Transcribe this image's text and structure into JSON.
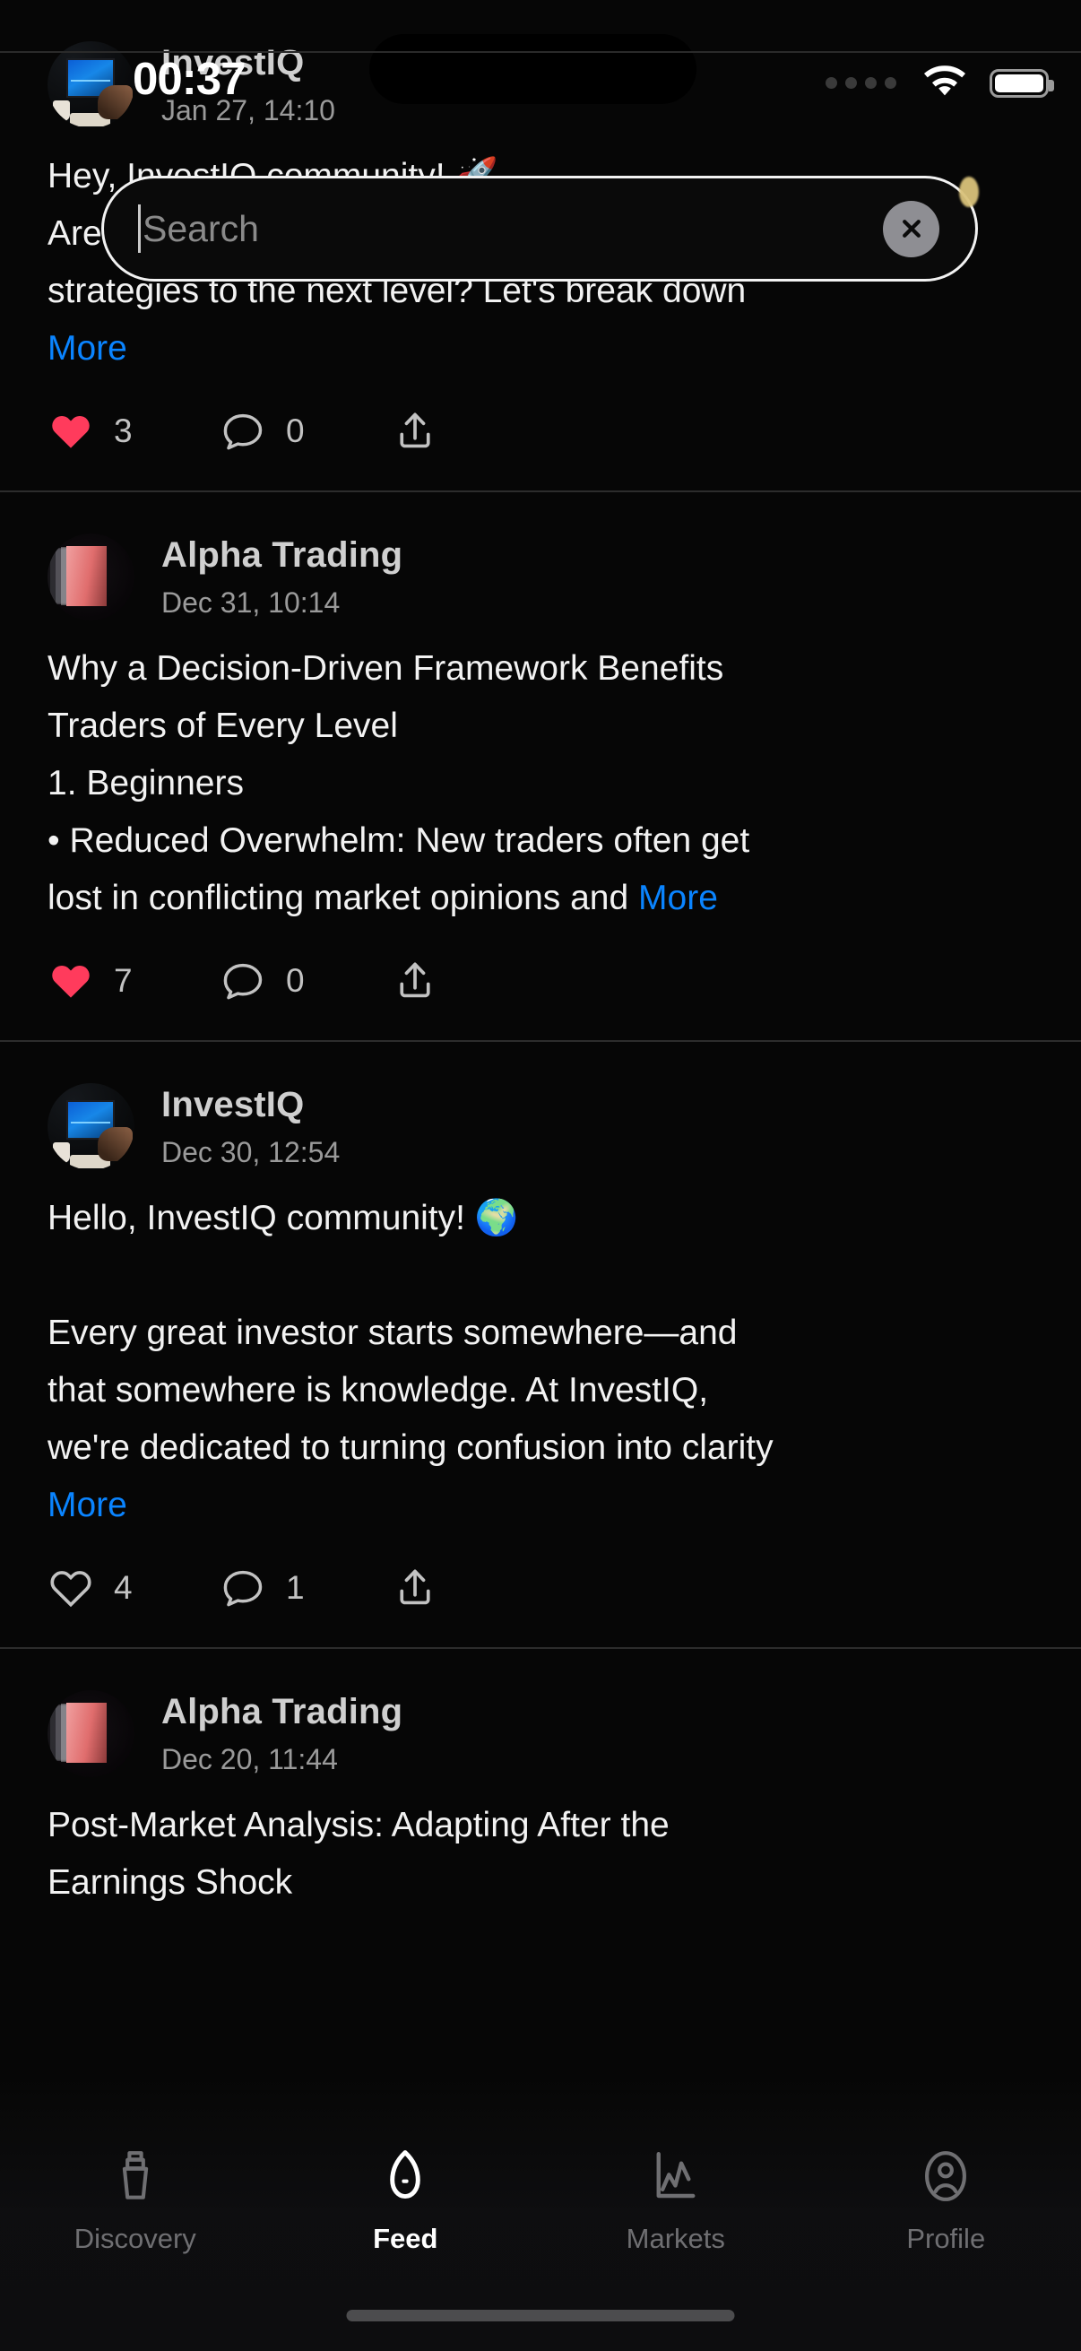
{
  "status_bar": {
    "time": "00:37",
    "signal_icon": "signal-dots-icon",
    "wifi_icon": "wifi-icon",
    "battery_icon": "battery-full-icon"
  },
  "search": {
    "placeholder": "Search",
    "value": "",
    "clear_icon": "close-circle-icon"
  },
  "feed": {
    "posts": [
      {
        "author": "InvestIQ",
        "timestamp": "Jan 27, 14:10",
        "avatar": "investiq-avatar",
        "lines": [
          "Hey, InvestIQ community! 🚀",
          "Are you ready to take your investment",
          "strategies to the next level? Let's break down"
        ],
        "more_label": "More",
        "liked": true,
        "like_count": "3",
        "comment_count": "0",
        "share_icon": "share-icon"
      },
      {
        "author": "Alpha Trading",
        "timestamp": "Dec 31, 10:14",
        "avatar": "alpha-trading-avatar",
        "lines": [
          "Why a Decision-Driven Framework Benefits",
          "Traders of Every Level",
          " 1. Beginners",
          " • Reduced Overwhelm: New traders often get",
          "lost in conflicting market opinions and "
        ],
        "more_label": "More",
        "liked": true,
        "like_count": "7",
        "comment_count": "0",
        "share_icon": "share-icon"
      },
      {
        "author": "InvestIQ",
        "timestamp": "Dec 30, 12:54",
        "avatar": "investiq-avatar",
        "lines": [
          "Hello, InvestIQ community! 🌍",
          "",
          "Every great investor starts somewhere—and",
          "that somewhere is knowledge. At InvestIQ,",
          "we're dedicated to turning confusion into clarity"
        ],
        "more_label": "More",
        "liked": false,
        "like_count": "4",
        "comment_count": "1",
        "share_icon": "share-icon"
      },
      {
        "author": "Alpha Trading",
        "timestamp": "Dec 20, 11:44",
        "avatar": "alpha-trading-avatar",
        "lines": [
          "Post-Market Analysis: Adapting After the",
          "Earnings Shock"
        ],
        "more_label": "",
        "liked": false,
        "like_count": "",
        "comment_count": "",
        "share_icon": "share-icon"
      }
    ]
  },
  "tabbar": {
    "items": [
      {
        "label": "Discovery",
        "icon": "telescope-icon",
        "active": false
      },
      {
        "label": "Feed",
        "icon": "feed-shield-icon",
        "active": true
      },
      {
        "label": "Markets",
        "icon": "chart-line-icon",
        "active": false
      },
      {
        "label": "Profile",
        "icon": "person-circle-icon",
        "active": false
      }
    ]
  },
  "colors": {
    "background": "#060606",
    "accent_link": "#0a84ff",
    "heart_filled": "#ff3b5c",
    "divider": "#2c2c2c",
    "muted_text": "#9a9a9a"
  }
}
